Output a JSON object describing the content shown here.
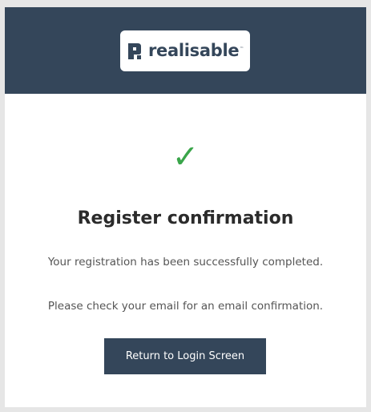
{
  "brand": {
    "name": "realisable",
    "trademark": "™",
    "header_color": "#34465a"
  },
  "status_icon": "checkmark-icon",
  "status_glyph": "✓",
  "status_color": "#3aa54a",
  "title": "Register confirmation",
  "messages": [
    "Your registration has been successfully completed.",
    "Please check your email for an email confirmation."
  ],
  "button": {
    "label": "Return to Login Screen"
  }
}
